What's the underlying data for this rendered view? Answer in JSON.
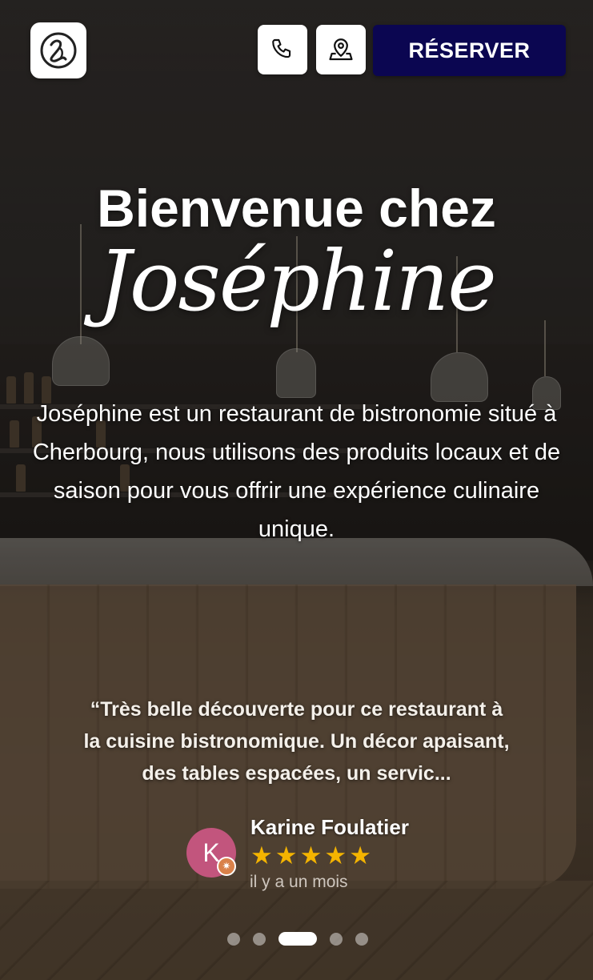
{
  "header": {
    "logo_icon": "josephine-logo-icon",
    "phone_icon": "phone-icon",
    "map_icon": "map-pin-icon",
    "reserve_label": "RÉSERVER"
  },
  "hero": {
    "title_line1": "Bienvenue chez",
    "title_line2": "Joséphine",
    "intro": "Joséphine est un restaurant de bistronomie situé à Cherbourg, nous utilisons des produits locaux et de saison pour vous offrir une expérience culinaire unique."
  },
  "review": {
    "quote": "“Très belle découverte pour ce restaurant à la cuisine bistronomique. Un décor apaisant, des tables espacées, un servic...",
    "avatar_letter": "K",
    "reviewer_name": "Karine Foulatier",
    "rating": 5,
    "rating_max": 5,
    "time_ago": "il y a un mois"
  },
  "carousel": {
    "count": 5,
    "active_index": 2
  },
  "colors": {
    "reserve_bg": "#0b0651",
    "star": "#f4b400",
    "avatar": "#c2557d"
  }
}
